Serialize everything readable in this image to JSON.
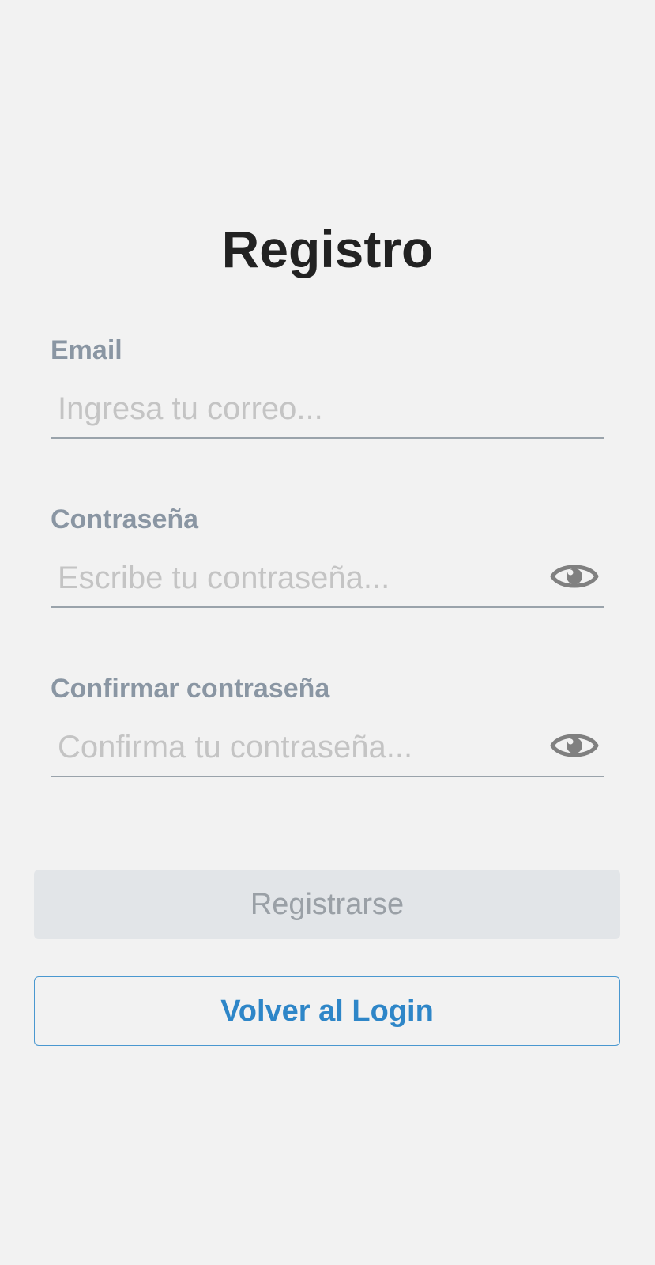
{
  "page": {
    "title": "Registro"
  },
  "form": {
    "email": {
      "label": "Email",
      "placeholder": "Ingresa tu correo...",
      "value": ""
    },
    "password": {
      "label": "Contraseña",
      "placeholder": "Escribe tu contraseña...",
      "value": "",
      "toggle_icon": "eye-icon"
    },
    "confirm_password": {
      "label": "Confirmar contraseña",
      "placeholder": "Confirma tu contraseña...",
      "value": "",
      "toggle_icon": "eye-icon"
    }
  },
  "actions": {
    "register_label": "Registrarse",
    "register_disabled": true,
    "back_label": "Volver al Login"
  },
  "colors": {
    "background": "#f2f2f2",
    "title": "#222222",
    "label": "#8a96a3",
    "placeholder": "#c4c4c4",
    "underline": "#9aa3ab",
    "disabled_button_bg": "#e2e5e8",
    "disabled_button_text": "#9aa0a6",
    "link_blue": "#2e86c8",
    "icon_gray": "#808080"
  }
}
